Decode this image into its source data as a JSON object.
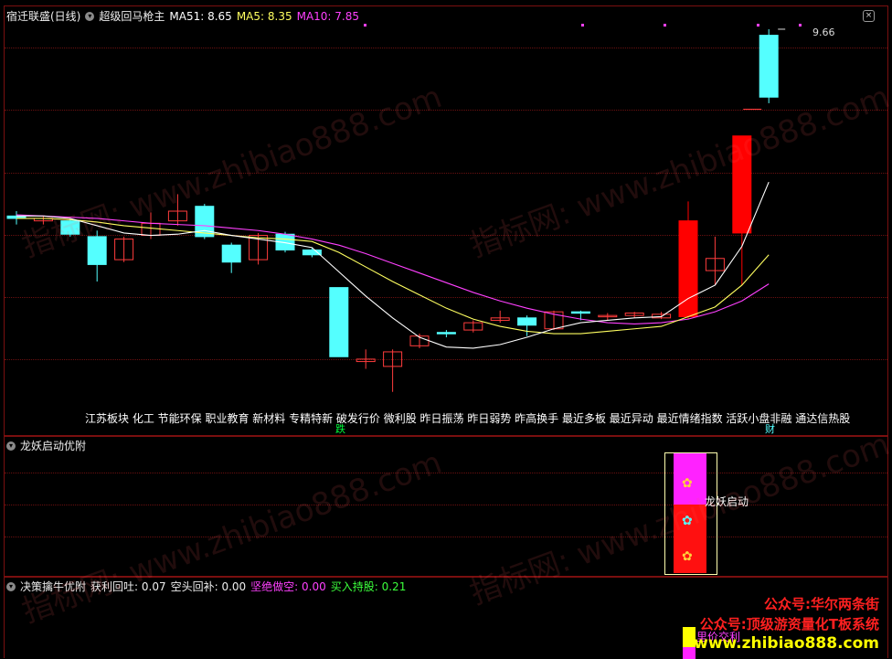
{
  "main": {
    "stock": "宿迁联盛(日线)",
    "indicator": "超级回马枪主",
    "ma51": "MA51: 8.65",
    "ma5": "MA5: 8.35",
    "ma10": "MA10: 7.85",
    "high_label": "9.66",
    "sectors": "江苏板块 化工 节能环保 职业教育 新材料  专精特新 破发行价 微利股 昨日振荡 昨日弱势 昨高换手 最近多板 最近异动 最近情绪指数 活跃小盘非融 通达信热股",
    "tag_die": "跌",
    "tag_cai": "财"
  },
  "panel2": {
    "title": "龙妖启动优附",
    "label": "龙妖启动"
  },
  "panel3": {
    "title": "决策擒牛优附",
    "profit": "获利回吐: 0.07",
    "short": "空头回补: 0.00",
    "firm": "坚绝做空: 0.00",
    "buy": "买入持股: 0.21"
  },
  "promo": {
    "line1": "公众号:华尔两条街",
    "line2": "公众号:顶级游资量化T板系统",
    "line3": "www.zhibiao888.com",
    "partial": "里价交利"
  },
  "watermark": {
    "a": "指标网: www.zhibiao888.com"
  },
  "colors": {
    "up": "#ff3c3c",
    "down": "#54ffff",
    "limit_up": "#ff0000",
    "limit_down": "#00ff3c",
    "ma5": "#ffffff",
    "ma10": "#ffff60",
    "ma51": "#ff40ff"
  },
  "chart_data": {
    "type": "candlestick",
    "candles": [
      {
        "o": 8.12,
        "c": 8.1,
        "h": 8.16,
        "l": 8.05
      },
      {
        "o": 8.08,
        "c": 8.1,
        "h": 8.12,
        "l": 8.05
      },
      {
        "o": 8.08,
        "c": 7.97,
        "h": 8.1,
        "l": 7.95
      },
      {
        "o": 7.95,
        "c": 7.72,
        "h": 8.0,
        "l": 7.58
      },
      {
        "o": 7.76,
        "c": 7.93,
        "h": 7.95,
        "l": 7.74
      },
      {
        "o": 7.96,
        "c": 8.06,
        "h": 8.15,
        "l": 7.93
      },
      {
        "o": 8.08,
        "c": 8.16,
        "h": 8.3,
        "l": 8.04
      },
      {
        "o": 8.2,
        "c": 7.95,
        "h": 8.22,
        "l": 7.93
      },
      {
        "o": 7.88,
        "c": 7.74,
        "h": 7.9,
        "l": 7.65
      },
      {
        "o": 7.76,
        "c": 7.96,
        "h": 7.98,
        "l": 7.72
      },
      {
        "o": 7.97,
        "c": 7.84,
        "h": 7.99,
        "l": 7.82
      },
      {
        "o": 7.84,
        "c": 7.8,
        "h": 7.86,
        "l": 7.78
      },
      {
        "o": 7.53,
        "c": 6.96,
        "h": 7.53,
        "l": 6.96
      },
      {
        "o": 6.92,
        "c": 6.94,
        "h": 7.02,
        "l": 6.86
      },
      {
        "o": 6.88,
        "c": 7.0,
        "h": 7.02,
        "l": 6.67
      },
      {
        "o": 7.05,
        "c": 7.13,
        "h": 7.15,
        "l": 7.03
      },
      {
        "o": 7.16,
        "c": 7.15,
        "h": 7.18,
        "l": 7.12
      },
      {
        "o": 7.18,
        "c": 7.24,
        "h": 7.26,
        "l": 7.16
      },
      {
        "o": 7.26,
        "c": 7.28,
        "h": 7.34,
        "l": 7.24
      },
      {
        "o": 7.28,
        "c": 7.22,
        "h": 7.3,
        "l": 7.13
      },
      {
        "o": 7.19,
        "c": 7.33,
        "h": 7.34,
        "l": 7.18
      },
      {
        "o": 7.33,
        "c": 7.32,
        "h": 7.34,
        "l": 7.26
      },
      {
        "o": 7.3,
        "c": 7.3,
        "h": 7.32,
        "l": 7.26
      },
      {
        "o": 7.3,
        "c": 7.32,
        "h": 7.33,
        "l": 7.28
      },
      {
        "o": 7.28,
        "c": 7.31,
        "h": 7.33,
        "l": 7.27
      },
      {
        "o": 7.29,
        "c": 8.08,
        "h": 8.24,
        "l": 7.27
      },
      {
        "o": 7.67,
        "c": 7.77,
        "h": 7.95,
        "l": 7.55
      },
      {
        "o": 7.98,
        "c": 8.78,
        "h": 8.78,
        "l": 7.55
      },
      {
        "o": 9.61,
        "c": 9.1,
        "h": 9.66,
        "l": 9.05
      }
    ],
    "ma5": [
      8.12,
      8.12,
      8.1,
      8.04,
      7.98,
      7.96,
      7.97,
      8.0,
      7.96,
      7.93,
      7.9,
      7.86,
      7.66,
      7.46,
      7.28,
      7.12,
      7.04,
      7.03,
      7.06,
      7.12,
      7.19,
      7.24,
      7.26,
      7.28,
      7.29,
      7.44,
      7.55,
      7.87,
      8.4
    ],
    "ma10": [
      8.1,
      8.1,
      8.09,
      8.07,
      8.04,
      8.02,
      8.0,
      7.98,
      7.96,
      7.94,
      7.93,
      7.91,
      7.82,
      7.7,
      7.58,
      7.47,
      7.36,
      7.27,
      7.21,
      7.17,
      7.15,
      7.15,
      7.17,
      7.19,
      7.21,
      7.29,
      7.37,
      7.55,
      7.8
    ],
    "ma51": [
      8.13,
      8.12,
      8.11,
      8.1,
      8.08,
      8.06,
      8.05,
      8.04,
      8.02,
      8.0,
      7.97,
      7.93,
      7.88,
      7.81,
      7.73,
      7.65,
      7.57,
      7.49,
      7.42,
      7.36,
      7.31,
      7.27,
      7.24,
      7.23,
      7.24,
      7.27,
      7.33,
      7.42,
      7.56
    ],
    "ylim": [
      6.54,
      9.72
    ]
  }
}
